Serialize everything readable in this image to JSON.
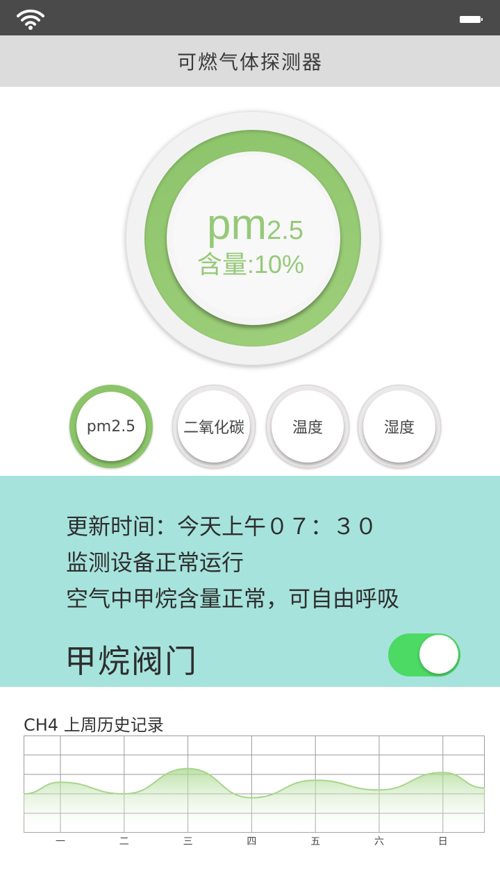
{
  "status_bar": {
    "wifi_icon": "wifi-icon",
    "battery_icon": "battery-icon"
  },
  "header": {
    "title": "可燃气体探测器"
  },
  "gauge": {
    "label_main": "pm",
    "label_sub": "2.5",
    "content_text": "含量:10%",
    "ring_color": "#8cc46a"
  },
  "sensors": [
    {
      "label": "pm2.5",
      "active": true
    },
    {
      "label": "二氧化碳",
      "active": false
    },
    {
      "label": "温度",
      "active": false
    },
    {
      "label": "湿度",
      "active": false
    }
  ],
  "info": {
    "update_time": "更新时间：今天上午０７：３０",
    "device_status": "监测设备正常运行",
    "air_status": "空气中甲烷含量正常，可自由呼吸",
    "valve_label": "甲烷阀门",
    "valve_on": true,
    "panel_color": "#a6e3dc",
    "toggle_color": "#4cd964"
  },
  "history": {
    "title": "CH4  上周历史记录"
  },
  "chart_data": {
    "type": "area",
    "categories": [
      "一",
      "二",
      "三",
      "四",
      "五",
      "六",
      "日"
    ],
    "series": [
      {
        "values": [
          2.6,
          2.0,
          3.3,
          1.8,
          2.7,
          2.2,
          3.1
        ]
      }
    ],
    "ylim": [
      0,
      5
    ],
    "grid": true,
    "line_color": "#a6d68a"
  }
}
